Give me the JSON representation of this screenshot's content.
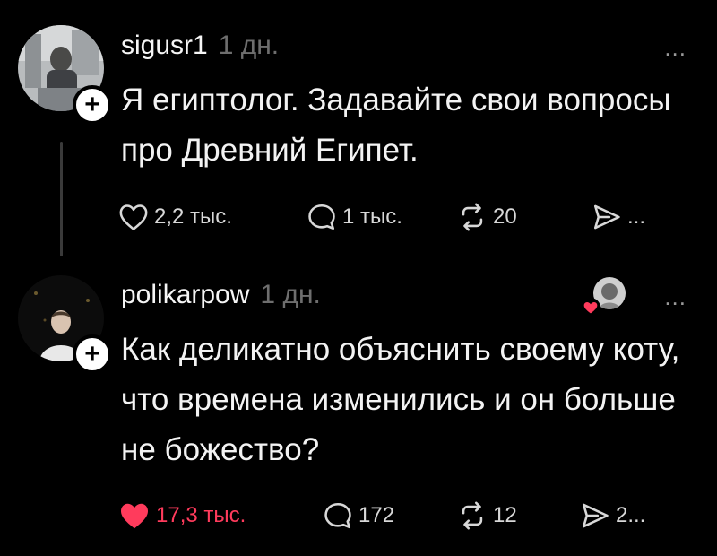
{
  "posts": [
    {
      "username": "sigusr1",
      "time": "1 дн.",
      "text": "Я египтолог. Задавайте свои вопросы про Древний Египет.",
      "likes": "2,2 тыс.",
      "comments": "1 тыс.",
      "reposts": "20",
      "shares": "...",
      "liked": false
    },
    {
      "username": "polikarpow",
      "time": "1 дн.",
      "text": "Как деликатно объяснить своему коту, что времена изменились и он больше не божество?",
      "likes": "17,3 тыс.",
      "comments": "172",
      "reposts": "12",
      "shares": "2...",
      "liked": true
    }
  ],
  "more_label": "...",
  "follow_label": "+",
  "colors": {
    "liked": "#ff3b5c",
    "muted": "#6e6e6e",
    "background": "#000000"
  },
  "icons": [
    "follow-plus-icon",
    "more-icon",
    "heart-icon",
    "comment-icon",
    "repost-icon",
    "share-icon"
  ]
}
